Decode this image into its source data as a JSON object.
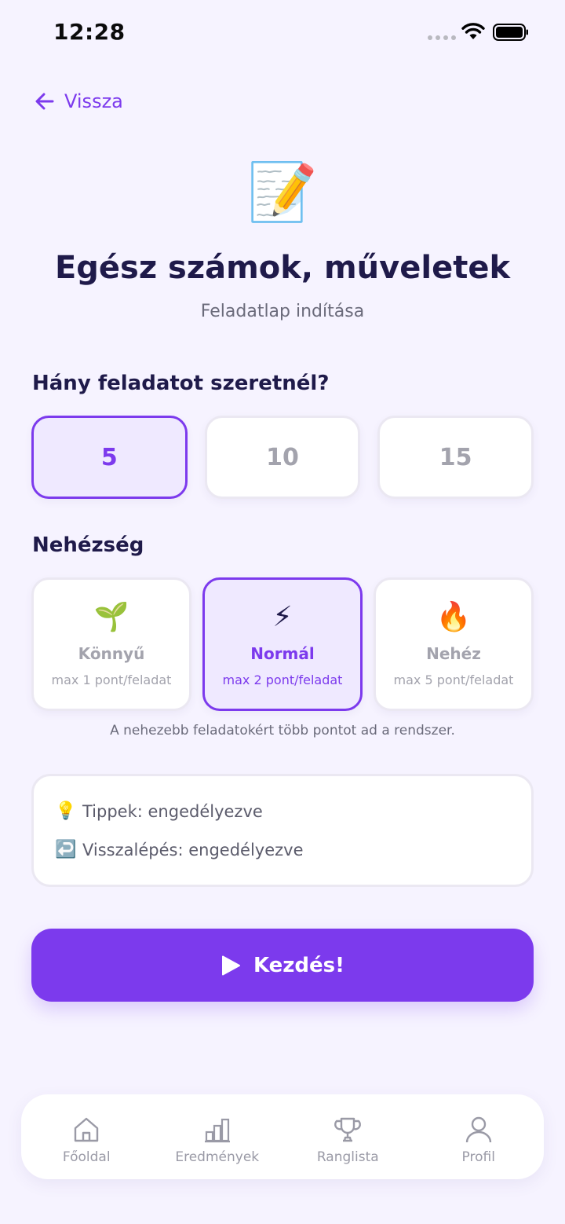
{
  "status_bar": {
    "time": "12:28"
  },
  "nav": {
    "back_label": "Vissza"
  },
  "header": {
    "emoji": "📝",
    "title": "Egész számok, műveletek",
    "subtitle": "Feladatlap indítása"
  },
  "count_section": {
    "title": "Hány feladatot szeretnél?",
    "options": [
      {
        "label": "5",
        "selected": true
      },
      {
        "label": "10",
        "selected": false
      },
      {
        "label": "15",
        "selected": false
      }
    ]
  },
  "difficulty_section": {
    "title": "Nehézség",
    "options": [
      {
        "icon": "🌱",
        "label": "Könnyű",
        "sub": "max 1 pont/feladat",
        "selected": false
      },
      {
        "icon": "⚡",
        "label": "Normál",
        "sub": "max 2 pont/feladat",
        "selected": true
      },
      {
        "icon": "🔥",
        "label": "Nehéz",
        "sub": "max 5 pont/feladat",
        "selected": false
      }
    ],
    "note": "A nehezebb feladatokért több pontot ad a rendszer."
  },
  "info": {
    "hints": {
      "icon": "💡",
      "text": "Tippek: engedélyezve"
    },
    "back_step": {
      "icon": "↩️",
      "text": "Visszalépés: engedélyezve"
    }
  },
  "start_button": {
    "label": "Kezdés!"
  },
  "tab_bar": {
    "items": [
      {
        "label": "Főoldal",
        "icon": "home-icon"
      },
      {
        "label": "Eredmények",
        "icon": "bar-chart-icon"
      },
      {
        "label": "Ranglista",
        "icon": "trophy-icon"
      },
      {
        "label": "Profil",
        "icon": "user-icon"
      }
    ]
  },
  "colors": {
    "accent": "#7c3aed",
    "background": "#f6f3ff",
    "muted": "#a3a3ad"
  }
}
